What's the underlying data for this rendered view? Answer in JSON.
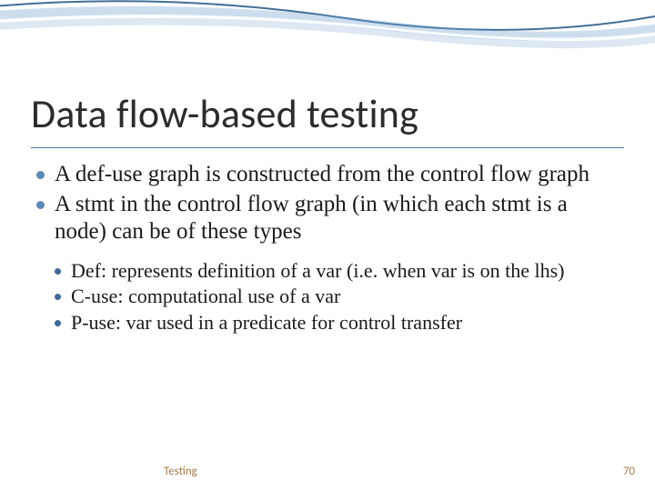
{
  "title": "Data flow-based testing",
  "bullets": {
    "level1": [
      "A def-use graph is constructed from the control flow graph",
      "A stmt in the control flow graph (in which each stmt is a node) can be of these types"
    ],
    "level2": [
      "Def: represents definition of a var (i.e. when var is on the lhs)",
      "C-use: computational use of a var",
      "P-use: var used in a predicate for control transfer"
    ]
  },
  "footer": {
    "label": "Testing",
    "page": "70"
  }
}
